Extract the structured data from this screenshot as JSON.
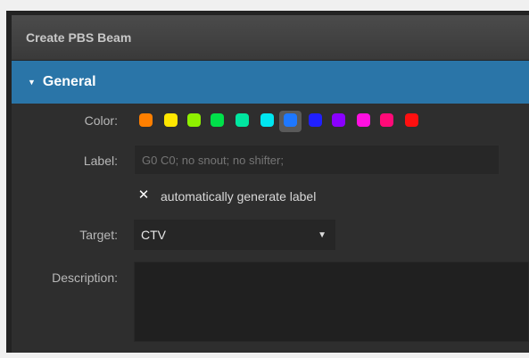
{
  "panel": {
    "title": "Create PBS Beam"
  },
  "general": {
    "section_title": "General",
    "color_label": "Color:",
    "colors": [
      "#ff7f00",
      "#ffe600",
      "#8ff000",
      "#00e04a",
      "#00e6a0",
      "#00e6f0",
      "#1e78ff",
      "#2020ff",
      "#8a00ff",
      "#ff10e0",
      "#ff0a78",
      "#ff1010"
    ],
    "selected_color_index": 6,
    "label_label": "Label:",
    "label_value": "",
    "label_placeholder": "G0 C0; no snout; no shifter;",
    "auto_label_checked": true,
    "auto_label_text": "automatically generate label",
    "target_label": "Target:",
    "target_value": "CTV",
    "description_label": "Description:",
    "description_value": ""
  }
}
